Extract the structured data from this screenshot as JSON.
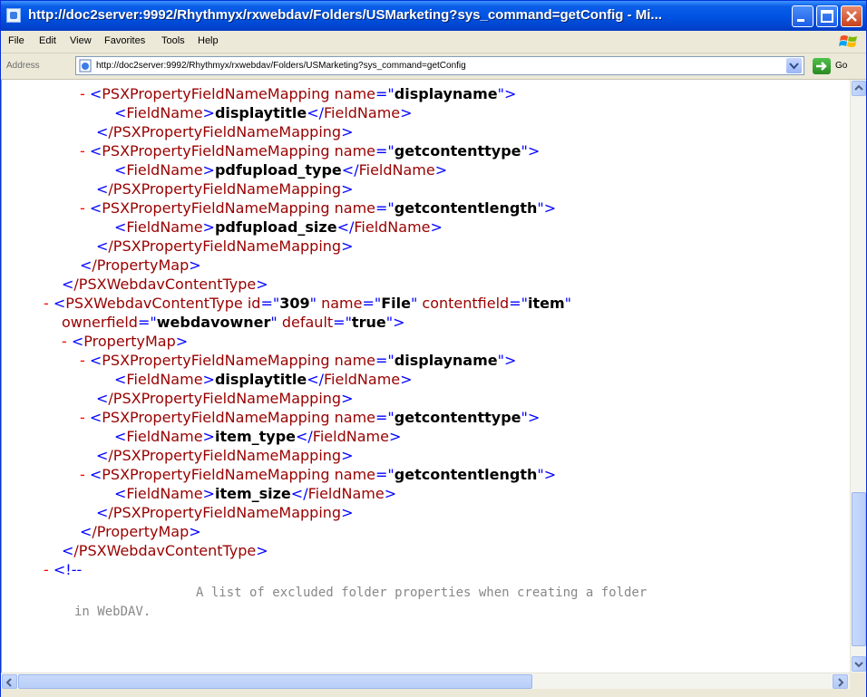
{
  "window": {
    "title": "http://doc2server:9992/Rhythmyx/rxwebdav/Folders/USMarketing?sys_command=getConfig - Mi..."
  },
  "menu": [
    "File",
    "Edit",
    "View",
    "Favorites",
    "Tools",
    "Help"
  ],
  "address": {
    "label": "Address",
    "url": "http://doc2server:9992/Rhythmyx/rxwebdav/Folders/USMarketing?sys_command=getConfig",
    "go": "Go"
  },
  "xml": {
    "l1": {
      "dash": "-",
      "tag": "PSXPropertyFieldNameMapping",
      "a1": "name",
      "v1": "displayname"
    },
    "l2": {
      "tag": "FieldName",
      "text": "displaytitle"
    },
    "l3": {
      "tag": "/PSXPropertyFieldNameMapping"
    },
    "l4": {
      "dash": "-",
      "tag": "PSXPropertyFieldNameMapping",
      "a1": "name",
      "v1": "getcontenttype"
    },
    "l5": {
      "tag": "FieldName",
      "text": "pdfupload_type"
    },
    "l6": {
      "tag": "/PSXPropertyFieldNameMapping"
    },
    "l7": {
      "dash": "-",
      "tag": "PSXPropertyFieldNameMapping",
      "a1": "name",
      "v1": "getcontentlength"
    },
    "l8": {
      "tag": "FieldName",
      "text": "pdfupload_size"
    },
    "l9": {
      "tag": "/PSXPropertyFieldNameMapping"
    },
    "l10": {
      "tag": "/PropertyMap"
    },
    "l11": {
      "tag": "/PSXWebdavContentType"
    },
    "l12": {
      "dash": "-",
      "tag": "PSXWebdavContentType",
      "a1": "id",
      "v1": "309",
      "a2": "name",
      "v2": "File",
      "a3": "contentfield",
      "v3": "item"
    },
    "l13": {
      "a1": "ownerfield",
      "v1": "webdavowner",
      "a2": "default",
      "v2": "true"
    },
    "l14": {
      "dash": "-",
      "tag": "PropertyMap"
    },
    "l15": {
      "dash": "-",
      "tag": "PSXPropertyFieldNameMapping",
      "a1": "name",
      "v1": "displayname"
    },
    "l16": {
      "tag": "FieldName",
      "text": "displaytitle"
    },
    "l17": {
      "tag": "/PSXPropertyFieldNameMapping"
    },
    "l18": {
      "dash": "-",
      "tag": "PSXPropertyFieldNameMapping",
      "a1": "name",
      "v1": "getcontenttype"
    },
    "l19": {
      "tag": "FieldName",
      "text": "item_type"
    },
    "l20": {
      "tag": "/PSXPropertyFieldNameMapping"
    },
    "l21": {
      "dash": "-",
      "tag": "PSXPropertyFieldNameMapping",
      "a1": "name",
      "v1": "getcontentlength"
    },
    "l22": {
      "tag": "FieldName",
      "text": "item_size"
    },
    "l23": {
      "tag": "/PSXPropertyFieldNameMapping"
    },
    "l24": {
      "tag": "/PropertyMap"
    },
    "l25": {
      "tag": "/PSXWebdavContentType"
    },
    "l26": {
      "dash": "-",
      "open": "<!--"
    },
    "l27": {
      "comment": "A list of excluded folder properties when creating a folder"
    },
    "l28": {
      "comment": "in WebDAV."
    }
  },
  "punct": {
    "lt": "<",
    "gt": ">",
    "ltslash": "</",
    "eq": "=",
    "q": "\""
  }
}
